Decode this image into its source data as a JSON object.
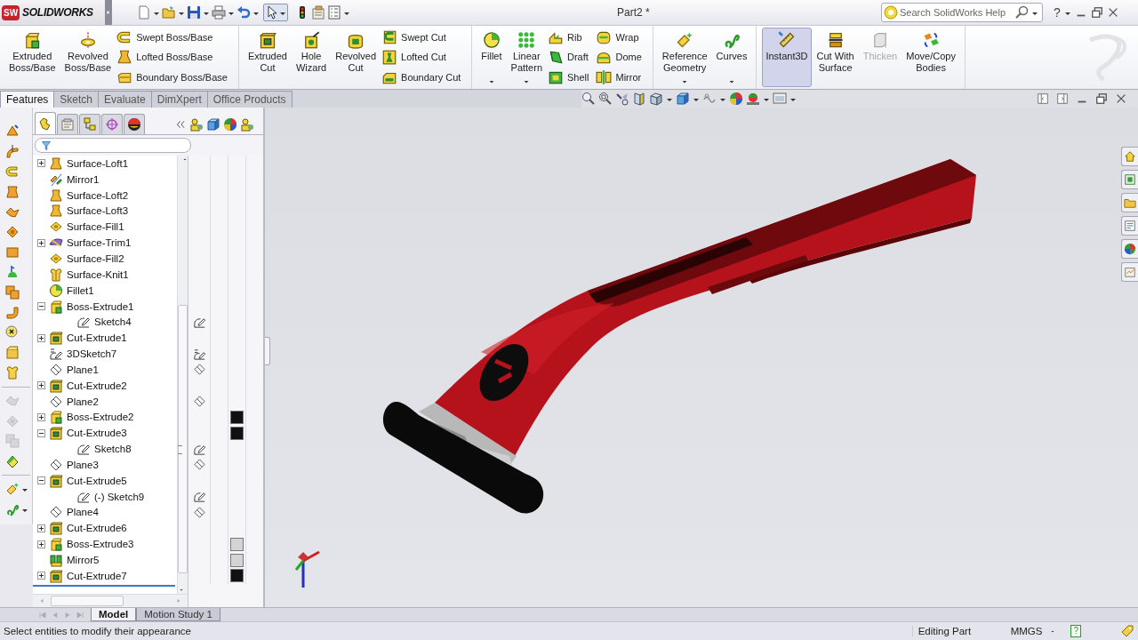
{
  "title_bar": {
    "logo_mark": "SW",
    "app_name": "SOLIDWORKS",
    "document_title": "Part2 *",
    "search": {
      "placeholder": "Search SolidWorks Help"
    },
    "help": "?"
  },
  "ribbon": {
    "groups": [
      {
        "items": [
          {
            "kind": "large",
            "label": "Extruded\nBoss/Base",
            "has_menu": false,
            "on": false,
            "disabled": false
          },
          {
            "kind": "large",
            "label": "Revolved\nBoss/Base",
            "has_menu": false,
            "on": false,
            "disabled": false
          },
          {
            "kind": "stack",
            "items": [
              {
                "label": "Swept Boss/Base"
              },
              {
                "label": "Lofted Boss/Base"
              },
              {
                "label": "Boundary Boss/Base"
              }
            ]
          }
        ]
      },
      {
        "items": [
          {
            "kind": "large",
            "label": "Extruded\nCut",
            "has_menu": false,
            "on": false,
            "disabled": false
          },
          {
            "kind": "large",
            "label": "Hole\nWizard",
            "has_menu": false,
            "on": false,
            "disabled": false
          },
          {
            "kind": "large",
            "label": "Revolved\nCut",
            "has_menu": false,
            "on": false,
            "disabled": false
          },
          {
            "kind": "stack",
            "items": [
              {
                "label": "Swept Cut"
              },
              {
                "label": "Lofted Cut"
              },
              {
                "label": "Boundary Cut"
              }
            ]
          }
        ]
      },
      {
        "items": [
          {
            "kind": "large",
            "label": "Fillet",
            "has_menu": true,
            "on": false,
            "disabled": false
          },
          {
            "kind": "large",
            "label": "Linear\nPattern",
            "has_menu": true,
            "on": false,
            "disabled": false
          },
          {
            "kind": "stack",
            "items": [
              {
                "label": "Rib"
              },
              {
                "label": "Draft"
              },
              {
                "label": "Shell"
              }
            ]
          },
          {
            "kind": "stack",
            "items": [
              {
                "label": "Wrap"
              },
              {
                "label": "Dome"
              },
              {
                "label": "Mirror"
              }
            ]
          }
        ]
      },
      {
        "items": [
          {
            "kind": "large",
            "label": "Reference\nGeometry",
            "has_menu": true,
            "on": false,
            "disabled": false
          },
          {
            "kind": "large",
            "label": "Curves",
            "has_menu": true,
            "on": false,
            "disabled": false
          }
        ]
      },
      {
        "items": [
          {
            "kind": "large",
            "label": "Instant3D",
            "has_menu": false,
            "on": true,
            "disabled": false
          },
          {
            "kind": "large",
            "label": "Cut With\nSurface",
            "has_menu": false,
            "on": false,
            "disabled": false
          },
          {
            "kind": "large",
            "label": "Thicken",
            "has_menu": false,
            "on": false,
            "disabled": true
          },
          {
            "kind": "large",
            "label": "Move/Copy\nBodies",
            "has_menu": false,
            "on": false,
            "disabled": false
          }
        ]
      }
    ]
  },
  "ribbon_tabs": [
    {
      "label": "Features",
      "selected": true
    },
    {
      "label": "Sketch",
      "selected": false
    },
    {
      "label": "Evaluate",
      "selected": false
    },
    {
      "label": "DimXpert",
      "selected": false
    },
    {
      "label": "Office Products",
      "selected": false
    }
  ],
  "left_toolbar": [
    {
      "disabled": false,
      "has_menu": false
    },
    {
      "disabled": false,
      "has_menu": false
    },
    {
      "disabled": false,
      "has_menu": false
    },
    {
      "disabled": false,
      "has_menu": false
    },
    {
      "disabled": false,
      "has_menu": false
    },
    {
      "disabled": false,
      "has_menu": false
    },
    {
      "disabled": false,
      "has_menu": false
    },
    {
      "disabled": false,
      "has_menu": false
    },
    {
      "disabled": false,
      "has_menu": false
    },
    {
      "disabled": false,
      "has_menu": false
    },
    {
      "disabled": false,
      "has_menu": false
    },
    {
      "disabled": false,
      "has_menu": false
    },
    {
      "disabled": false,
      "has_menu": false
    },
    {
      "disabled": true,
      "has_menu": false
    },
    {
      "disabled": true,
      "has_menu": false
    },
    {
      "disabled": true,
      "has_menu": false
    },
    {
      "disabled": false,
      "has_menu": false
    },
    {
      "disabled": false,
      "has_menu": true
    },
    {
      "disabled": false,
      "has_menu": true
    }
  ],
  "feature_manager": {
    "tabs": [
      {
        "selected": true
      },
      {
        "selected": false
      },
      {
        "selected": false
      },
      {
        "selected": false
      },
      {
        "selected": false
      }
    ],
    "tree": [
      {
        "label": "Surface-Loft1",
        "kind": "loft",
        "expanded": false
      },
      {
        "label": "Mirror1",
        "kind": "mirror"
      },
      {
        "label": "Surface-Loft2",
        "kind": "loft"
      },
      {
        "label": "Surface-Loft3",
        "kind": "loft"
      },
      {
        "label": "Surface-Fill1",
        "kind": "fill"
      },
      {
        "label": "Surface-Trim1",
        "kind": "trim",
        "expanded": false
      },
      {
        "label": "Surface-Fill2",
        "kind": "fill"
      },
      {
        "label": "Surface-Knit1",
        "kind": "knit"
      },
      {
        "label": "Fillet1",
        "kind": "fillet"
      },
      {
        "label": "Boss-Extrude1",
        "kind": "boss",
        "expanded": true,
        "children": [
          {
            "label": "Sketch4",
            "kind": "sketch"
          }
        ]
      },
      {
        "label": "Cut-Extrude1",
        "kind": "cut",
        "expanded": false
      },
      {
        "label": "3DSketch7",
        "kind": "sketch3d"
      },
      {
        "label": "Plane1",
        "kind": "plane"
      },
      {
        "label": "Cut-Extrude2",
        "kind": "cut",
        "expanded": false
      },
      {
        "label": "Plane2",
        "kind": "plane"
      },
      {
        "label": "Boss-Extrude2",
        "kind": "boss",
        "expanded": false,
        "color": "#111111"
      },
      {
        "label": "Cut-Extrude3",
        "kind": "cut",
        "expanded": true,
        "color": "#111111",
        "children": [
          {
            "label": "Sketch8",
            "kind": "sketch"
          }
        ]
      },
      {
        "label": "Plane3",
        "kind": "plane"
      },
      {
        "label": "Cut-Extrude5",
        "kind": "cut",
        "expanded": true,
        "children": [
          {
            "label": "(-) Sketch9",
            "kind": "sketch"
          }
        ]
      },
      {
        "label": "Plane4",
        "kind": "plane"
      },
      {
        "label": "Cut-Extrude6",
        "kind": "cut",
        "expanded": false
      },
      {
        "label": "Boss-Extrude3",
        "kind": "boss",
        "expanded": false,
        "color": "#d4d4d4"
      },
      {
        "label": "Mirror5",
        "kind": "mirrorbody",
        "color": "#d4d4d4"
      },
      {
        "label": "Cut-Extrude7",
        "kind": "cut",
        "expanded": false,
        "color": "#111111"
      }
    ]
  },
  "bottom_tabs": [
    {
      "label": "Model",
      "selected": true
    },
    {
      "label": "Motion Study 1",
      "selected": false
    }
  ],
  "status_bar": {
    "message": "Select entities to modify their appearance",
    "mode": "Editing Part",
    "units": "MMGS",
    "help": "?"
  }
}
